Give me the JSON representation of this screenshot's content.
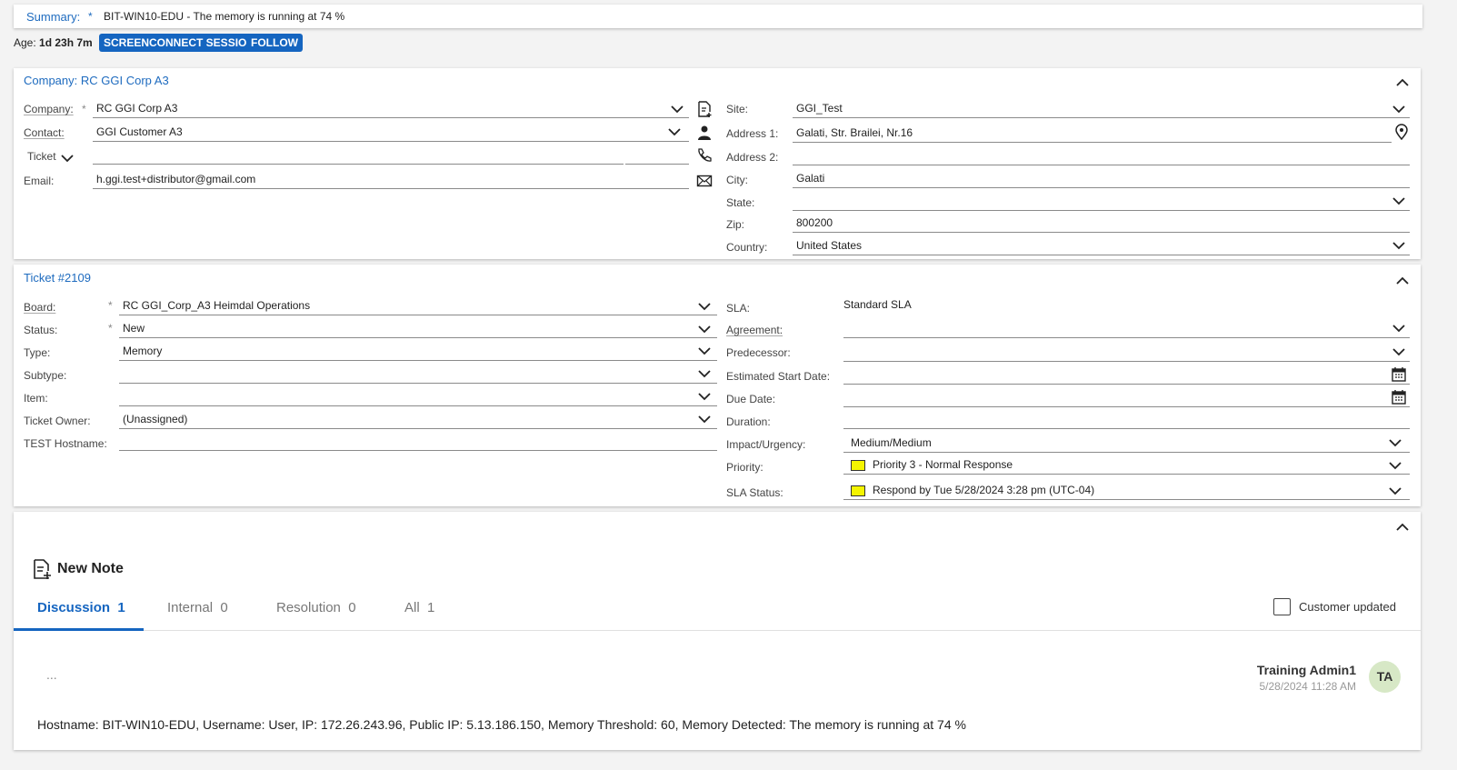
{
  "summary": {
    "label": "Summary:",
    "req": "*",
    "value": "BIT-WIN10-EDU - The memory is running at 74 %"
  },
  "age": {
    "label": "Age:",
    "value": "1d 23h 7m"
  },
  "buttons": {
    "screenconnect": "SCREENCONNECT SESSION",
    "follow": "FOLLOW"
  },
  "company_panel": {
    "title": "Company: RC GGI Corp A3",
    "company_label": "Company:",
    "company_value": "RC GGI Corp A3",
    "contact_label": "Contact:",
    "contact_value": "GGI Customer A3",
    "ticket_label": "Ticket",
    "email_label": "Email:",
    "email_value": "h.ggi.test+distributor@gmail.com",
    "site_label": "Site:",
    "site_value": "GGI_Test",
    "address1_label": "Address 1:",
    "address1_value": "Galati, Str. Brailei, Nr.16",
    "address2_label": "Address 2:",
    "address2_value": "",
    "city_label": "City:",
    "city_value": "Galati",
    "state_label": "State:",
    "state_value": "",
    "zip_label": "Zip:",
    "zip_value": "800200",
    "country_label": "Country:",
    "country_value": "United States"
  },
  "ticket_panel": {
    "title": "Ticket #2109",
    "board_label": "Board:",
    "board_value": "RC GGI_Corp_A3 Heimdal Operations",
    "status_label": "Status:",
    "status_value": "New",
    "type_label": "Type:",
    "type_value": "Memory",
    "subtype_label": "Subtype:",
    "subtype_value": "",
    "item_label": "Item:",
    "item_value": "",
    "owner_label": "Ticket Owner:",
    "owner_value": "(Unassigned)",
    "hostname_label": "TEST Hostname:",
    "hostname_value": "",
    "sla_label": "SLA:",
    "sla_value": "Standard SLA",
    "agreement_label": "Agreement:",
    "predecessor_label": "Predecessor:",
    "est_start_label": "Estimated Start Date:",
    "due_label": "Due Date:",
    "duration_label": "Duration:",
    "impact_label": "Impact/Urgency:",
    "impact_value": "Medium/Medium",
    "priority_label": "Priority:",
    "priority_value": "Priority 3 - Normal Response",
    "sla_status_label": "SLA Status:",
    "sla_status_value": "Respond by Tue 5/28/2024 3:28 pm (UTC-04)",
    "priority_color": "#f4f400"
  },
  "notes": {
    "new_note": "New Note",
    "tabs": [
      {
        "label": "Discussion",
        "count": "1"
      },
      {
        "label": "Internal",
        "count": "0"
      },
      {
        "label": "Resolution",
        "count": "0"
      },
      {
        "label": "All",
        "count": "1"
      }
    ],
    "customer_updated": "Customer updated",
    "more": "...",
    "author": "Training Admin1",
    "date": "5/28/2024 11:28 AM",
    "initials": "TA",
    "body": "Hostname: BIT-WIN10-EDU, Username: User, IP: 172.26.243.96, Public IP: 5.13.186.150, Memory Threshold: 60, Memory Detected: The memory is running at 74 %"
  },
  "colors": {
    "accent": "#1565c0",
    "avatar_bg": "#d7e8c6"
  }
}
